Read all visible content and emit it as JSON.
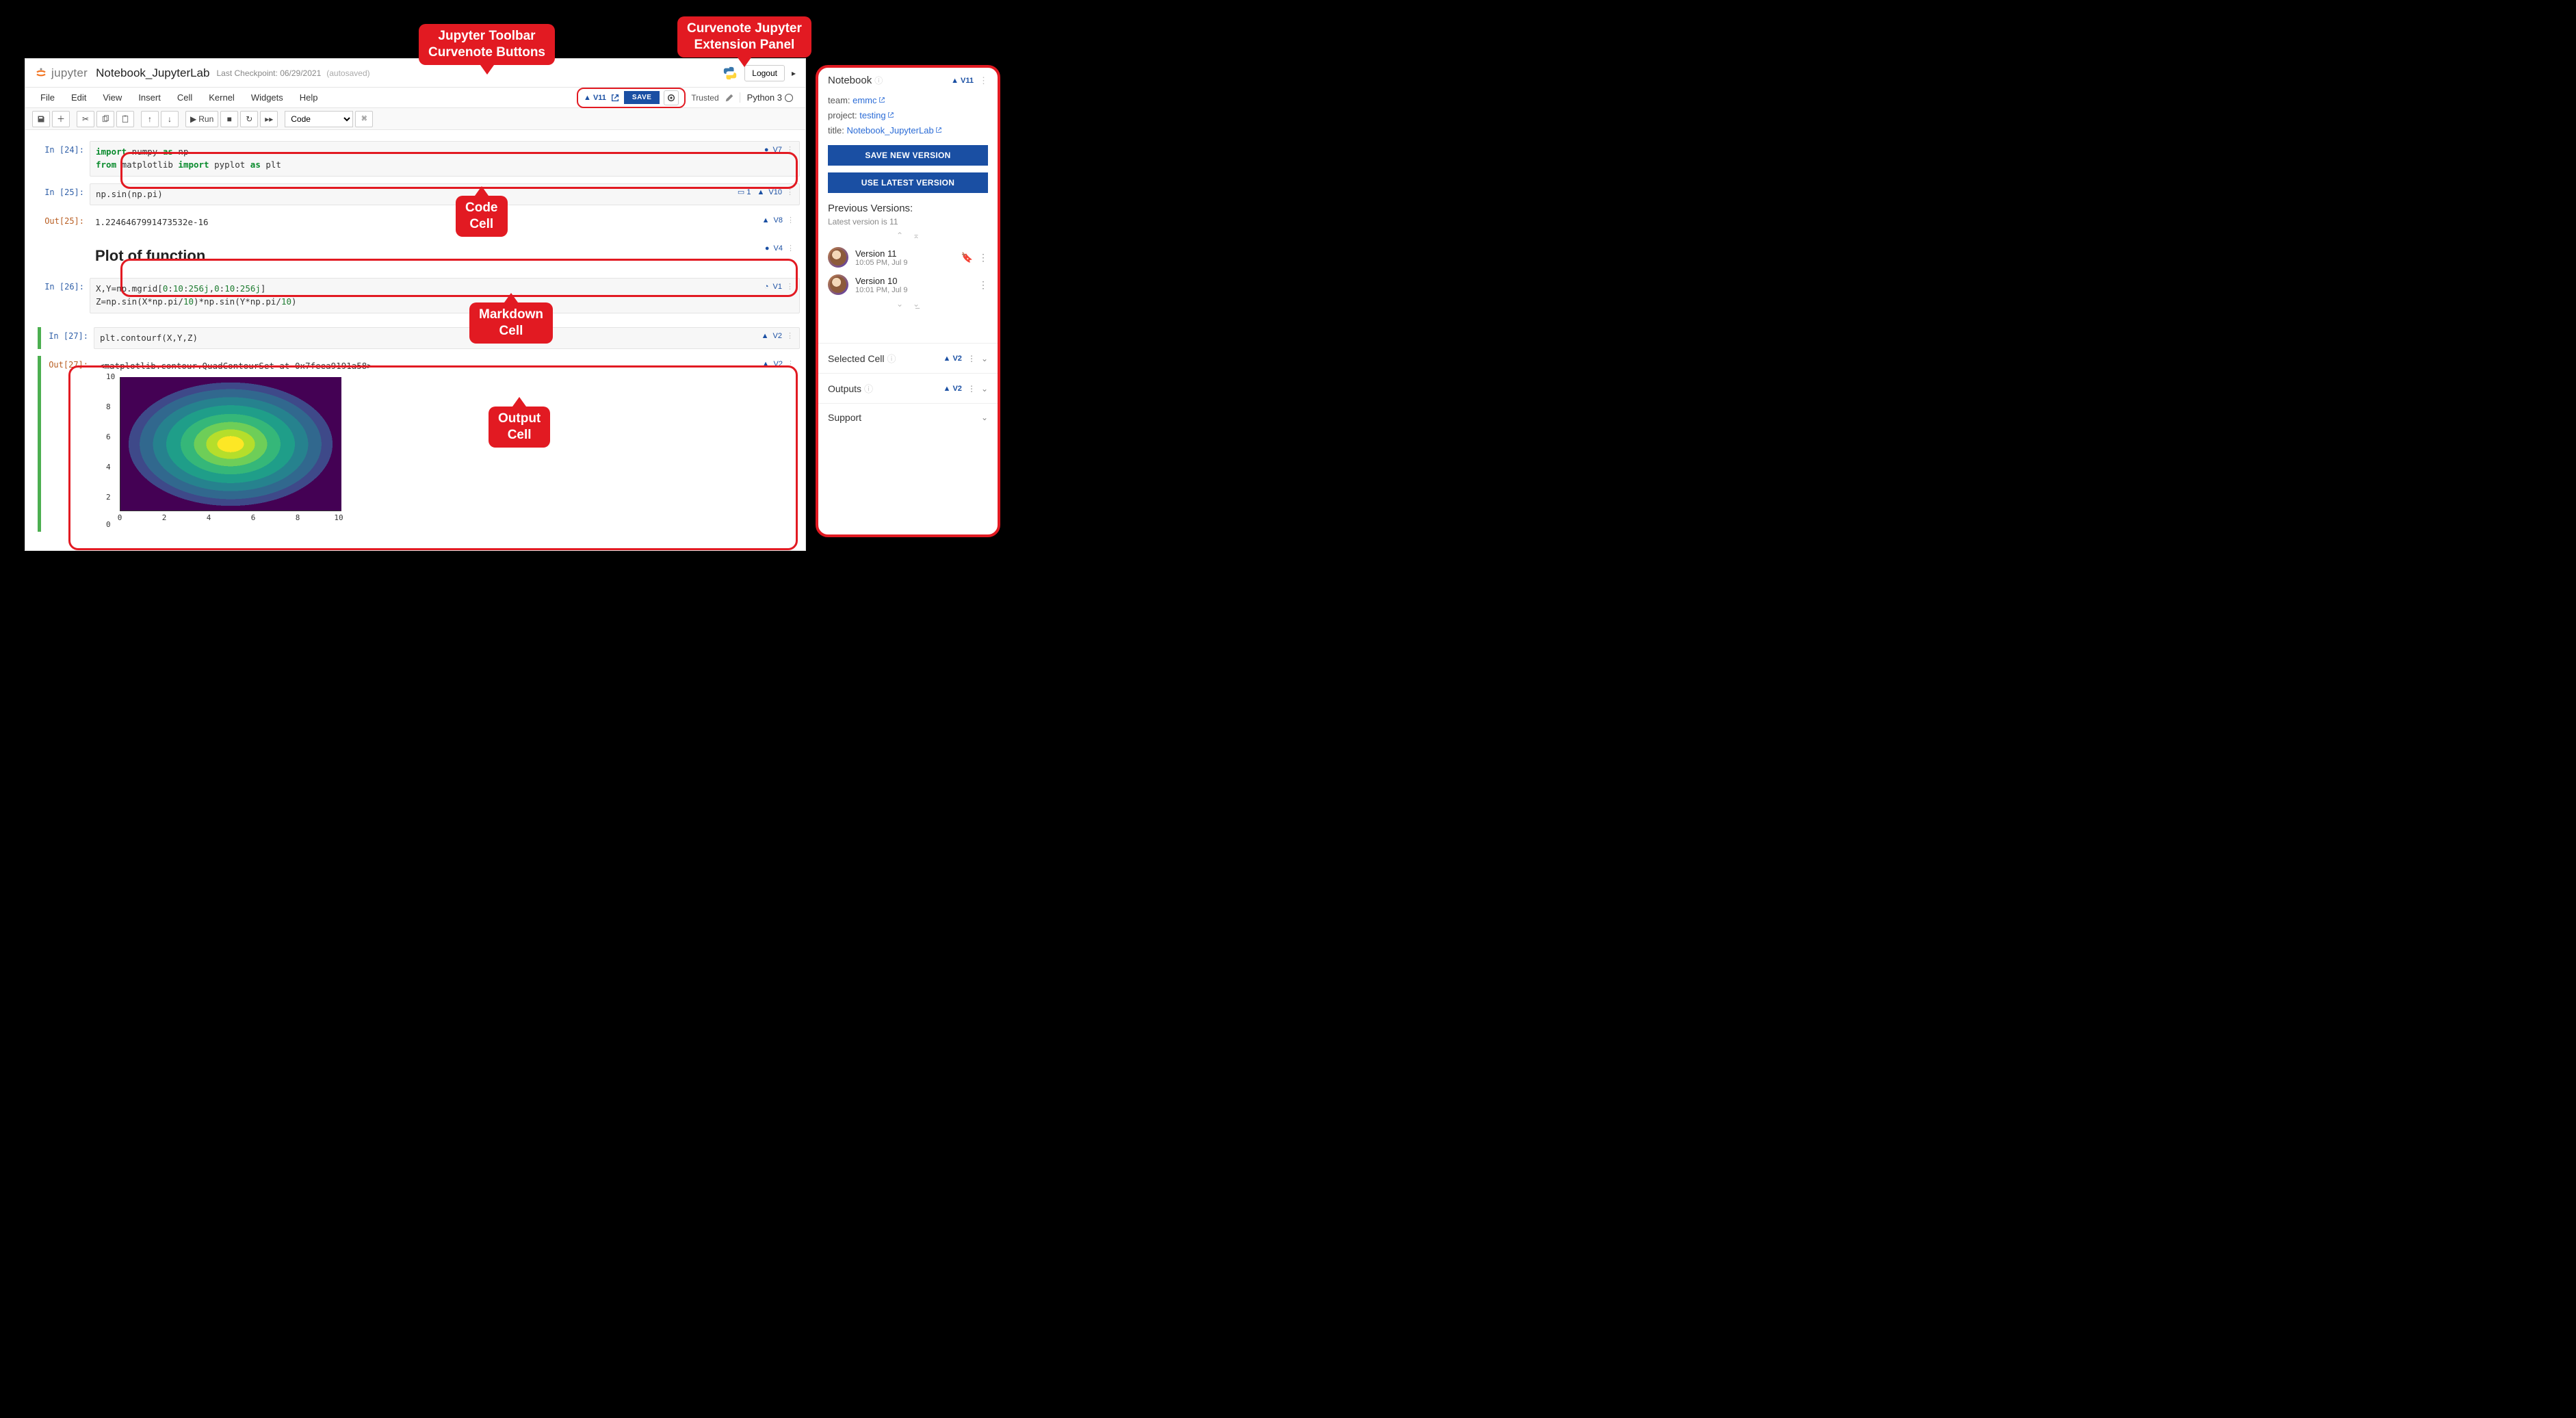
{
  "header": {
    "logo_text": "jupyter",
    "notebook_title": "Notebook_JupyterLab",
    "checkpoint": "Last Checkpoint: 06/29/2021",
    "autosave": "(autosaved)",
    "logout": "Logout"
  },
  "menubar": {
    "items": [
      "File",
      "Edit",
      "View",
      "Insert",
      "Cell",
      "Kernel",
      "Widgets",
      "Help"
    ],
    "curvenote": {
      "version": "▲ V11",
      "save": "SAVE"
    },
    "trusted": "Trusted",
    "kernel": "Python 3"
  },
  "toolbar": {
    "run_label": "Run",
    "celltype": "Code"
  },
  "cells": {
    "c1": {
      "in": "In [24]:",
      "badge": "V7",
      "line1a": "import",
      "line1b": " numpy ",
      "line1c": "as",
      "line1d": " np",
      "line2a": "from",
      "line2b": " matplotlib ",
      "line2c": "import",
      "line2d": " pyplot ",
      "line2e": "as",
      "line2f": " plt"
    },
    "c2": {
      "in": "In [25]:",
      "code": "np.sin(np.pi)",
      "badge": "V10",
      "comments": "1"
    },
    "c2o": {
      "out": "Out[25]:",
      "text": "1.2246467991473532e-16",
      "badge": "V8"
    },
    "md": {
      "heading": "Plot of function",
      "badge": "V4"
    },
    "c3": {
      "in": "In [26]:",
      "badge": "V1",
      "t1": "X,Y=np.mgrid[",
      "n1": "0",
      "t2": ":",
      "n2": "10",
      "t3": ":",
      "n3": "256j",
      "t4": ",",
      "n4": "0",
      "t5": ":",
      "n5": "10",
      "t6": ":",
      "n6": "256j",
      "t7": "]",
      "l2a": "Z=np.sin(X*np.pi/",
      "l2n1": "10",
      "l2b": ")*np.sin(Y*np.pi/",
      "l2n2": "10",
      "l2c": ")"
    },
    "c4": {
      "in": "In [27]:",
      "code": "plt.contourf(X,Y,Z)",
      "badge": "V2"
    },
    "c4o": {
      "out": "Out[27]:",
      "text": "<matplotlib.contour.QuadContourSet at 0x7feea9191a58>",
      "badge": "V2"
    }
  },
  "chart_data": {
    "type": "heatmap",
    "title": "",
    "xlabel": "",
    "ylabel": "",
    "xlim": [
      0,
      10
    ],
    "ylim": [
      0,
      10
    ],
    "xticks": [
      0,
      2,
      4,
      6,
      8,
      10
    ],
    "yticks": [
      0,
      2,
      4,
      6,
      8,
      10
    ],
    "function": "Z = sin(X*pi/10) * sin(Y*pi/10)",
    "colormap": "viridis"
  },
  "panel": {
    "title": "Notebook",
    "version": "▲ V11",
    "team_label": "team: ",
    "team": "emmc",
    "project_label": "project: ",
    "project": "testing",
    "title_label": "title: ",
    "nb": "Notebook_JupyterLab",
    "save_btn": "SAVE NEW VERSION",
    "use_btn": "USE LATEST VERSION",
    "prev_heading": "Previous Versions:",
    "latest_note": "Latest version is 11",
    "versions": [
      {
        "name": "Version 11",
        "date": "10:05 PM, Jul 9",
        "bookmark": true
      },
      {
        "name": "Version 10",
        "date": "10:01 PM, Jul 9",
        "bookmark": false
      }
    ],
    "selected_cell": {
      "title": "Selected Cell",
      "ver": "▲ V2"
    },
    "outputs": {
      "title": "Outputs",
      "ver": "▲ V2"
    },
    "support": "Support"
  },
  "annotations": {
    "toolbar": "Jupyter Toolbar\nCurvenote Buttons",
    "ext_panel": "Curvenote Jupyter\nExtension Panel",
    "code_cell": "Code\nCell",
    "md_cell": "Markdown\nCell",
    "out_cell": "Output\nCell"
  }
}
